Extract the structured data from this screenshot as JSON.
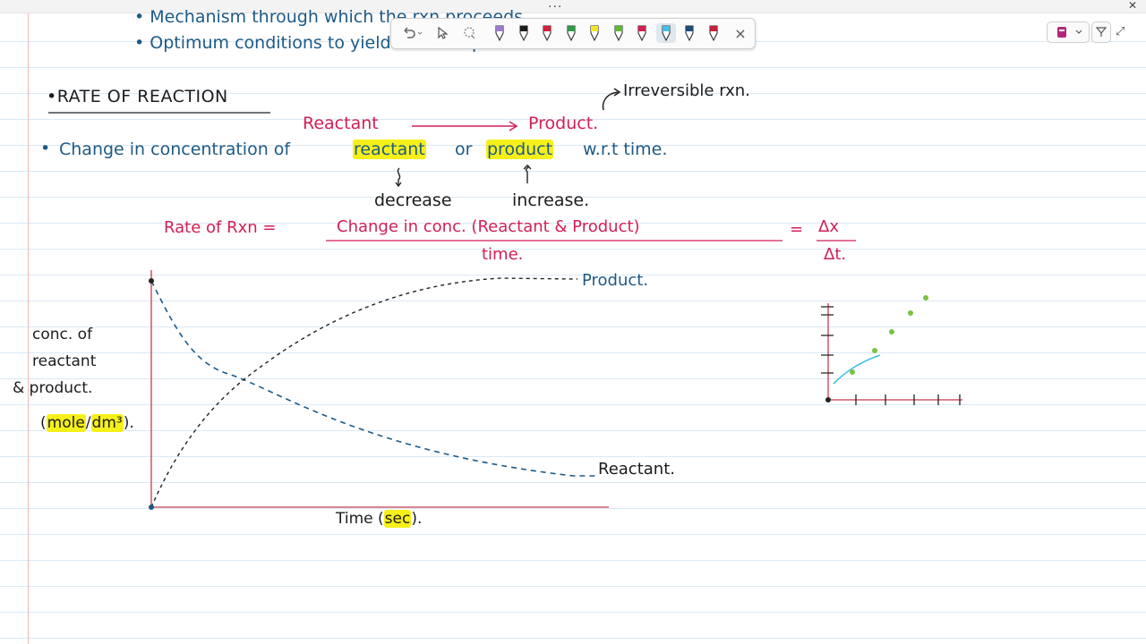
{
  "window": {
    "more_label": "...",
    "close_label": "✕"
  },
  "toolbar": {
    "undo_icon": "undo-icon",
    "select_icon": "cursor-icon",
    "lasso_icon": "lasso-icon",
    "close_label": "×",
    "pens": [
      {
        "name": "pen-lavender",
        "color": "#9b7ad1"
      },
      {
        "name": "pen-black",
        "color": "#1c1c1c"
      },
      {
        "name": "pen-red",
        "color": "#d21f3a"
      },
      {
        "name": "pen-green",
        "color": "#2e9a4a"
      },
      {
        "name": "highlighter-yellow",
        "color": "#f5e623"
      },
      {
        "name": "pen-lime",
        "color": "#5dbb2f"
      },
      {
        "name": "pen-pink",
        "color": "#d21f55"
      },
      {
        "name": "highlighter-cyan",
        "color": "#41bfe8",
        "selected": true
      },
      {
        "name": "pen-navy",
        "color": "#1d4d7a"
      },
      {
        "name": "pen-marker-red",
        "color": "#c0233a"
      }
    ]
  },
  "notes": {
    "top_line1": "• Mechanism through which the rxn proceeds",
    "top_line2": "• Optimum conditions to yield the best product",
    "heading": "•RATE OF REACTION",
    "irreversible": "Irreversible rxn.",
    "reactant": "Reactant",
    "product": "Product.",
    "change_bullet": "•",
    "change_pre": "Change in concentration of",
    "reactant_word": "reactant",
    "or_word": "or",
    "product_word": "product",
    "wrt": "w.r.t time.",
    "decrease": "decrease",
    "increase": "increase.",
    "rate_label": "Rate of Rxn =",
    "numerator": "Change in conc. (Reactant & Product)",
    "denominator": "time.",
    "equals": "=",
    "dx": "Δx",
    "dt": "Δt.",
    "ylabel1": "conc. of",
    "ylabel2": "reactant",
    "ylabel3": "& product.",
    "unit_open": "(",
    "unit_mole": "mole",
    "unit_slash": "/",
    "unit_dm": "dm³",
    "unit_close": ").",
    "xlabel_pre": "Time (",
    "xlabel_sec": "sec",
    "xlabel_post": ").",
    "product_curve_label": "Product.",
    "reactant_curve_label": "Reactant."
  },
  "colors": {
    "ink_blue": "#1d5a86",
    "ink_red": "#d21f55",
    "highlight": "#f5f01a",
    "axis": "#c83a4e"
  }
}
